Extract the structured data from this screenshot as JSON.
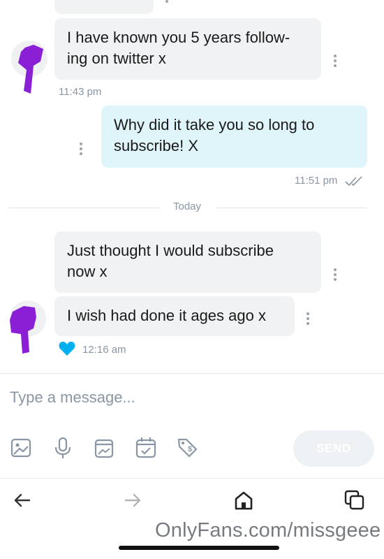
{
  "messages": [
    {
      "text": "I have known you 5 years follow-\ning on twitter x"
    },
    {
      "text": "Why did it take you so long to\nsubscribe! X"
    },
    {
      "text": "Just thought I would subscribe\nnow x"
    },
    {
      "text": "I wish had done it ages ago x"
    }
  ],
  "timestamps": {
    "first": "11:43 pm",
    "second": "11:51 pm",
    "third": "12:16 am"
  },
  "divider_label": "Today",
  "composer": {
    "placeholder": "Type a message...",
    "send_label": "SEND"
  },
  "watermark": "OnlyFans.com/missgeee",
  "icons": {
    "toolbar": [
      "image-icon",
      "microphone-icon",
      "media-vault-icon",
      "calendar-check-icon",
      "price-tag-icon"
    ],
    "nav": [
      "back-arrow-icon",
      "forward-arrow-icon",
      "home-icon",
      "tabs-icon"
    ],
    "status": [
      "read-double-check-icon",
      "liked-heart-icon",
      "more-options-icon"
    ]
  },
  "colors": {
    "incoming_bubble": "#f0f2f4",
    "outgoing_bubble": "#dff5f9",
    "accent_blue": "#00aff0",
    "avatar_scribble": "#8a1fd6"
  }
}
